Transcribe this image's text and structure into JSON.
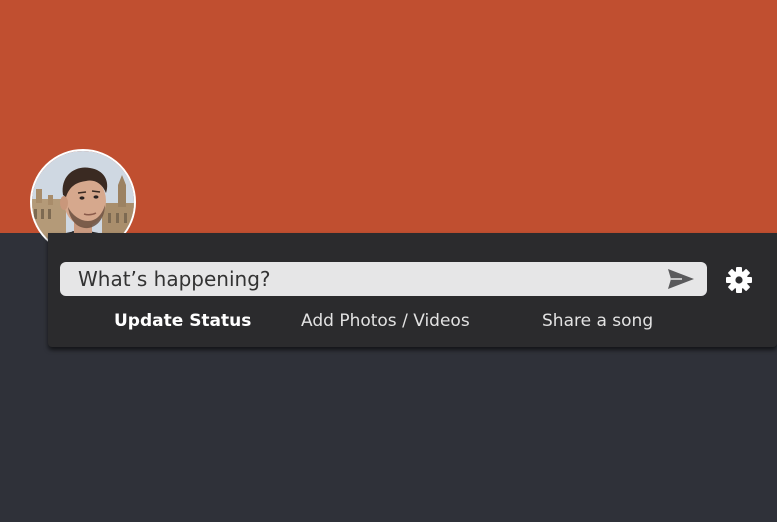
{
  "profile": {
    "cover_color": "#c04f30",
    "avatar_alt": "Profile photo"
  },
  "composer": {
    "placeholder": "What’s happening?",
    "send_icon": "send-icon",
    "settings_icon": "gear-icon"
  },
  "actions": [
    {
      "label": "Update Status",
      "active": true
    },
    {
      "label": "Add Photos / Videos",
      "active": false
    },
    {
      "label": "Share a song",
      "active": false
    }
  ]
}
